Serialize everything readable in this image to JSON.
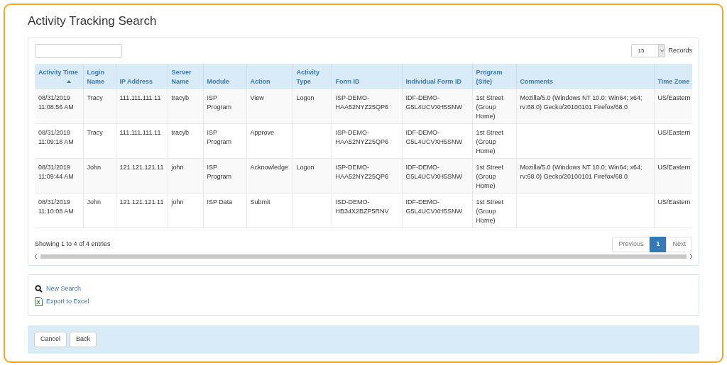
{
  "title": "Activity Tracking Search",
  "page_size": {
    "value": "15",
    "label": "Records"
  },
  "table": {
    "columns": [
      {
        "label": "Activity Time",
        "sorted": true
      },
      {
        "label": "Login Name",
        "sorted": false
      },
      {
        "label": "IP Address",
        "sorted": false
      },
      {
        "label": "Server Name",
        "sorted": false
      },
      {
        "label": "Module",
        "sorted": false
      },
      {
        "label": "Action",
        "sorted": false
      },
      {
        "label": "Activity Type",
        "sorted": false
      },
      {
        "label": "Form ID",
        "sorted": false
      },
      {
        "label": "Individual Form ID",
        "sorted": false
      },
      {
        "label": "Program (Site)",
        "sorted": false
      },
      {
        "label": "Comments",
        "sorted": false
      },
      {
        "label": "Time Zone",
        "sorted": false
      }
    ],
    "rows": [
      [
        "08/31/2019 11:08:56 AM",
        "Tracy",
        "111.111.111.11",
        "tracyb",
        "ISP Program",
        "View",
        "Logon",
        "ISP-DEMO-HAA52NYZ25QP6",
        "IDF-DEMO-G5L4UCVXH5SNW",
        "1st Street (Group Home)",
        "Mozilla/5.0 (Windows NT 10.0; Win64; x64; rv:68.0) Gecko/20100101 Firefox/68.0",
        "US/Eastern"
      ],
      [
        "08/31/2019 11:09:18 AM",
        "Tracy",
        "111.111.111.11",
        "tracyb",
        "ISP Program",
        "Approve",
        "",
        "ISP-DEMO-HAA52NYZ25QP6",
        "IDF-DEMO-G5L4UCVXH5SNW",
        "1st Street (Group Home)",
        "",
        "US/Eastern"
      ],
      [
        "08/31/2019 11:09:44 AM",
        "John",
        "121.121.121.11",
        "john",
        "ISP Program",
        "Acknowledge",
        "Logon",
        "ISP-DEMO-HAA52NYZ25QP6",
        "IDF-DEMO-G5L4UCVXH5SNW",
        "1st Street (Group Home)",
        "Mozilla/5.0 (Windows NT 10.0; Win64; x64; rv:68.0) Gecko/20100101 Firefox/68.0",
        "US/Eastern"
      ],
      [
        "08/31/2019 11:10:08 AM",
        "John",
        "121.121.121.11",
        "john",
        "ISP Data",
        "Submit",
        "",
        "ISD-DEMO-HB34X2BZP5RNV",
        "IDF-DEMO-G5L4UCVXH5SNW",
        "1st Street (Group Home)",
        "",
        "US/Eastern"
      ]
    ]
  },
  "info": "Showing 1 to 4 of 4 entries",
  "pagination": [
    {
      "label": "Previous",
      "kind": "prev",
      "selected": false
    },
    {
      "label": "1",
      "kind": "page",
      "selected": true
    },
    {
      "label": "Next",
      "kind": "next",
      "selected": false
    }
  ],
  "links": [
    {
      "label": "New Search",
      "kind": "search"
    },
    {
      "label": "Export to Excel",
      "kind": "excel"
    }
  ],
  "buttons": [
    "Cancel",
    "Back"
  ]
}
